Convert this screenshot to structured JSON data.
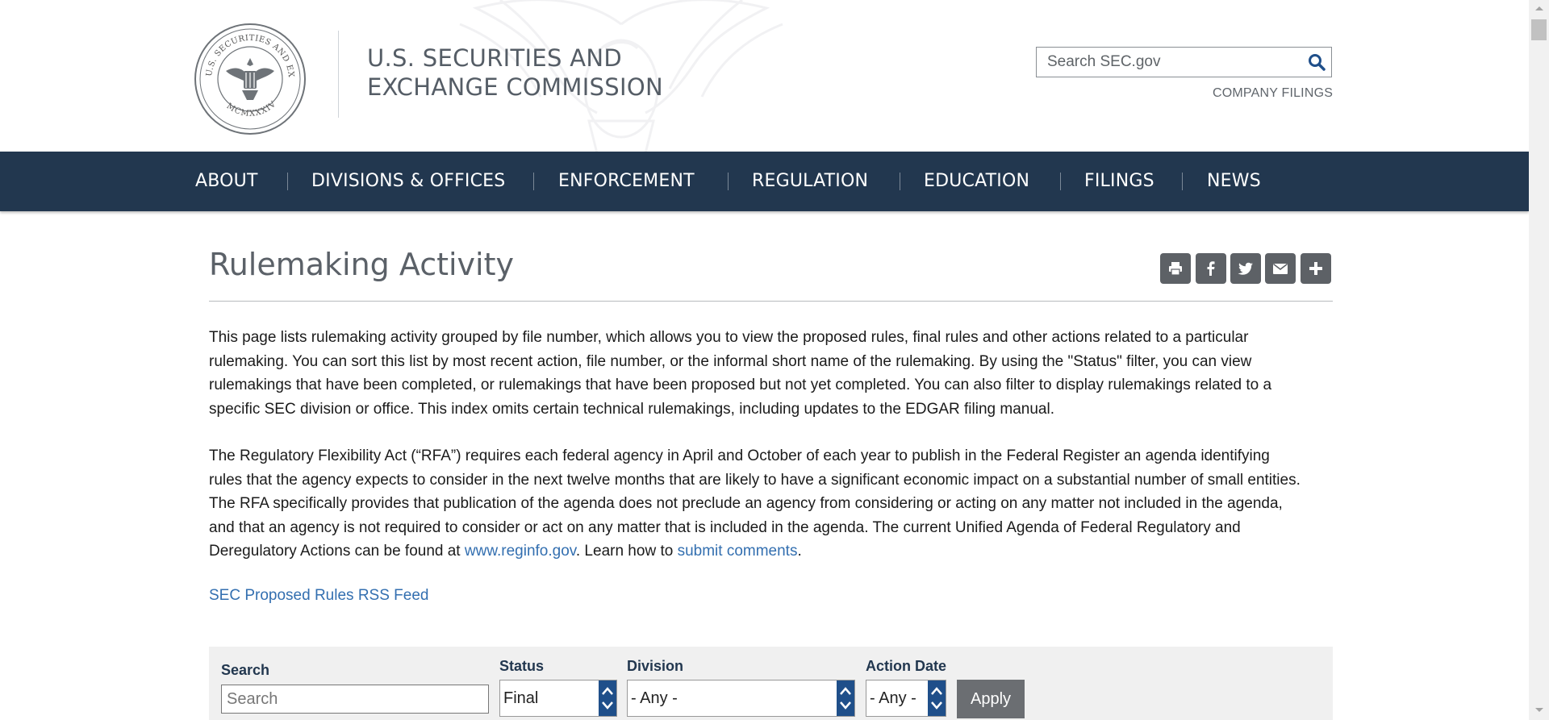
{
  "header": {
    "agency_line1": "U.S. SECURITIES AND",
    "agency_line2": "EXCHANGE COMMISSION",
    "search_placeholder": "Search SEC.gov",
    "company_filings": "COMPANY FILINGS",
    "seal_text_top": "U.S. SECURITIES AND EXCHANGE COMMISSION",
    "seal_text_bottom": "MCMXXXIV"
  },
  "nav": {
    "items": [
      "ABOUT",
      "DIVISIONS & OFFICES",
      "ENFORCEMENT",
      "REGULATION",
      "EDUCATION",
      "FILINGS",
      "NEWS"
    ]
  },
  "main": {
    "title": "Rulemaking Activity",
    "share_icons": [
      "print-icon",
      "facebook-icon",
      "twitter-icon",
      "email-icon",
      "plus-icon"
    ],
    "intro_lines": [
      "This page lists rulemaking activity grouped by file number, which allows you to view the proposed rules, final rules and other actions related to a particular",
      "rulemaking. You can sort this list by most recent action, file number, or the informal short name of the rulemaking. By using the \"Status\" filter, you can view",
      "rulemakings that have been completed, or rulemakings that have been proposed but not yet completed. You can also filter to display rulemakings related to a",
      "specific SEC division or office. This index omits certain technical rulemakings, including updates to the EDGAR filing manual."
    ],
    "rfa_lines": [
      "The Regulatory Flexibility Act (“RFA”) requires each federal agency in April and October of each year to publish in the Federal Register an agenda identifying",
      "rules that the agency expects to consider in the next twelve months that are likely to have a significant economic impact on a substantial number of small entities.",
      "The RFA specifically provides that publication of the agenda does not preclude an agency from considering or acting on any matter not included in the agenda,",
      "and that an agency is not required to consider or act on any matter that is included in the agenda. The current Unified Agenda of Federal Regulatory and"
    ],
    "rfa_last_prefix": "Deregulatory Actions can be found at ",
    "reginfo_link": "www.reginfo.gov",
    "rfa_last_middle": ". Learn how to ",
    "submit_link": "submit comments",
    "rfa_last_suffix": ".",
    "rss_link": "SEC Proposed Rules RSS Feed"
  },
  "filters": {
    "search_label": "Search",
    "search_placeholder": "Search",
    "status_label": "Status",
    "status_value": "Final",
    "division_label": "Division",
    "division_value": "- Any -",
    "action_date_label": "Action Date",
    "action_date_value": "- Any -",
    "apply_label": "Apply"
  },
  "colors": {
    "nav_bg": "#22374f",
    "link": "#336fb0",
    "filter_bg": "#f0f0f0",
    "spinner": "#1f4f8a",
    "apply_bg": "#6b6e72",
    "share_bg": "#5d6166"
  }
}
